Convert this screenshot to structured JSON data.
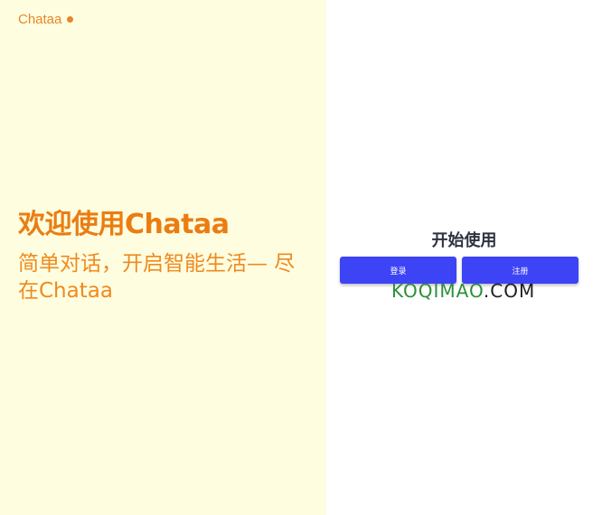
{
  "brand": {
    "name": "Chataa",
    "accent": "#e8862b"
  },
  "hero": {
    "title": "欢迎使用Chataa",
    "subtitle": "简单对话，开启智能生活— 尽在Chataa"
  },
  "auth": {
    "heading": "开始使用",
    "login_label": "登录",
    "register_label": "注册",
    "button_color": "#3d44f6"
  },
  "watermark": {
    "part1": "KOQIMAO",
    "part2": ".COM"
  }
}
